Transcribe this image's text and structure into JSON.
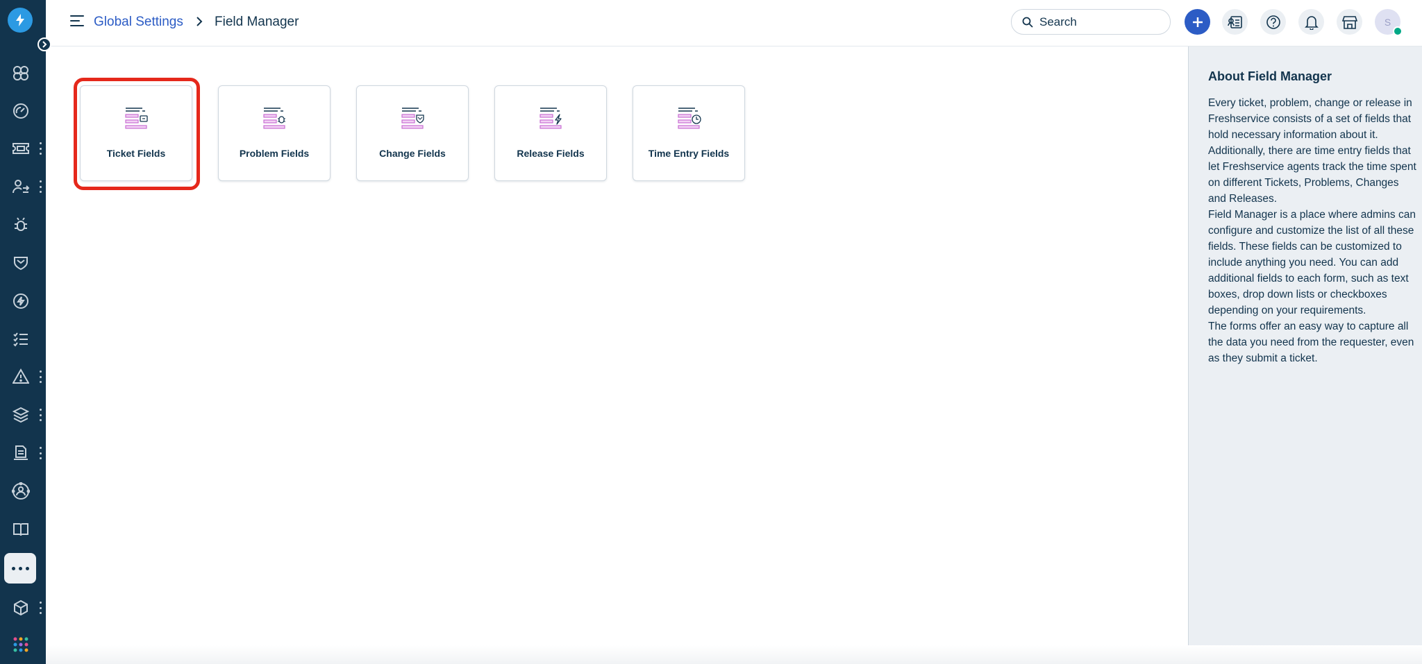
{
  "breadcrumb": {
    "parent": "Global Settings",
    "current": "Field Manager"
  },
  "search": {
    "placeholder": "Search"
  },
  "user": {
    "initial": "S"
  },
  "colors": {
    "accent": "#2c5cc5",
    "sidebar": "#12344d",
    "highlight": "#e5281b",
    "icon_pink": "#c86fd2"
  },
  "sidebar": {
    "items": [
      {
        "icon": "dashboard-icon"
      },
      {
        "icon": "gauge-icon"
      },
      {
        "icon": "ticket-icon"
      },
      {
        "icon": "user-sync-icon"
      },
      {
        "icon": "bug-icon"
      },
      {
        "icon": "shield-icon"
      },
      {
        "icon": "bolt-icon"
      },
      {
        "icon": "checklist-icon"
      },
      {
        "icon": "alert-icon"
      },
      {
        "icon": "layers-icon"
      },
      {
        "icon": "document-icon"
      },
      {
        "icon": "network-icon"
      },
      {
        "icon": "book-icon"
      },
      {
        "icon": "more-icon"
      },
      {
        "icon": "cube-icon"
      },
      {
        "icon": "apps-icon"
      }
    ]
  },
  "cards": [
    {
      "label": "Ticket Fields",
      "icon": "ticket-fields-icon"
    },
    {
      "label": "Problem Fields",
      "icon": "problem-fields-icon"
    },
    {
      "label": "Change Fields",
      "icon": "change-fields-icon"
    },
    {
      "label": "Release Fields",
      "icon": "release-fields-icon"
    },
    {
      "label": "Time Entry Fields",
      "icon": "time-entry-fields-icon"
    }
  ],
  "about": {
    "title": "About Field Manager",
    "paragraphs": [
      "Every ticket, problem, change or release in Freshservice consists of a set of fields that hold necessary information about it. Additionally, there are time entry fields that let Freshservice agents track the time spent on different Tickets, Problems, Changes and Releases.",
      "Field Manager is a place where admins can configure and customize the list of all these fields. These fields can be customized to include anything you need. You can add additional fields to each form, such as text boxes, drop down lists or checkboxes depending on your requirements.",
      "The forms offer an easy way to capture all the data you need from the requester, even as they submit a ticket."
    ]
  }
}
